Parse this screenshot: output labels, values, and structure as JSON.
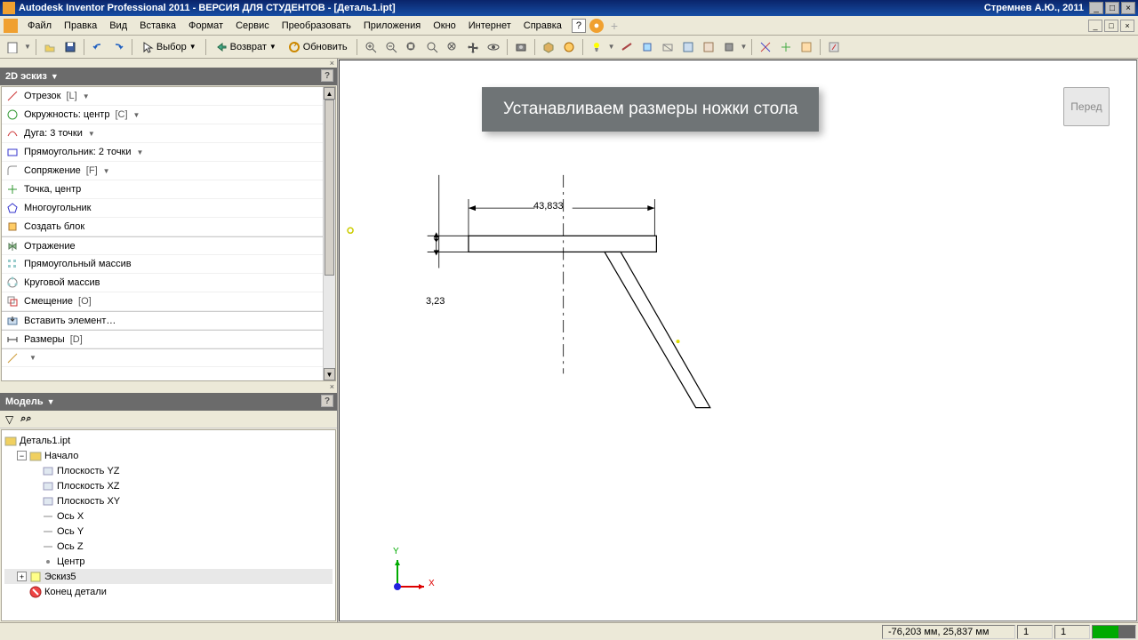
{
  "titlebar": {
    "app": "Autodesk Inventor Professional 2011 - ВЕРСИЯ ДЛЯ СТУДЕНТОВ - [Деталь1.ipt]",
    "credit": "Стремнев А.Ю., 2011"
  },
  "menu": {
    "items": [
      "Файл",
      "Правка",
      "Вид",
      "Вставка",
      "Формат",
      "Сервис",
      "Преобразовать",
      "Приложения",
      "Окно",
      "Интернет",
      "Справка"
    ]
  },
  "toolbar": {
    "select_label": "Выбор",
    "return_label": "Возврат",
    "update_label": "Обновить"
  },
  "sketch_panel": {
    "title": "2D эскиз",
    "tools": [
      {
        "label": "Отрезок",
        "key": "[L]",
        "dd": true,
        "icon": "line"
      },
      {
        "label": "Окружность: центр",
        "key": "[C]",
        "dd": true,
        "icon": "circle"
      },
      {
        "label": "Дуга: 3 точки",
        "dd": true,
        "icon": "arc"
      },
      {
        "label": "Прямоугольник: 2 точки",
        "dd": true,
        "icon": "rect"
      },
      {
        "label": "Сопряжение",
        "key": "[F]",
        "dd": true,
        "icon": "fillet"
      },
      {
        "label": "Точка, центр",
        "icon": "point"
      },
      {
        "label": "Многоугольник",
        "icon": "polygon"
      },
      {
        "label": "Создать блок",
        "icon": "block"
      },
      {
        "label": "Отражение",
        "icon": "mirror",
        "sep": true
      },
      {
        "label": "Прямоугольный массив",
        "icon": "rectarr"
      },
      {
        "label": "Круговой массив",
        "icon": "circarr"
      },
      {
        "label": "Смещение",
        "key": "[O]",
        "icon": "offset"
      },
      {
        "label": "Вставить элемент…",
        "icon": "insert",
        "sep": true
      },
      {
        "label": "Размеры",
        "key": "[D]",
        "icon": "dim",
        "sep": true
      }
    ]
  },
  "model_panel": {
    "title": "Модель",
    "tree": {
      "root": "Деталь1.ipt",
      "origin": "Начало",
      "planes": [
        "Плоскость YZ",
        "Плоскость XZ",
        "Плоскость XY"
      ],
      "axes": [
        "Ось X",
        "Ось Y",
        "Ось Z"
      ],
      "center": "Центр",
      "sketch": "Эскиз5",
      "end": "Конец детали"
    }
  },
  "canvas": {
    "overlay": "Устанавливаем размеры ножки стола",
    "view_btn": "Перед",
    "dim_w": "43,833",
    "dim_h": "3,23",
    "axis_x": "X",
    "axis_y": "Y"
  },
  "statusbar": {
    "coords": "-76,203 мм, 25,837 мм",
    "field1": "1",
    "field2": "1"
  }
}
